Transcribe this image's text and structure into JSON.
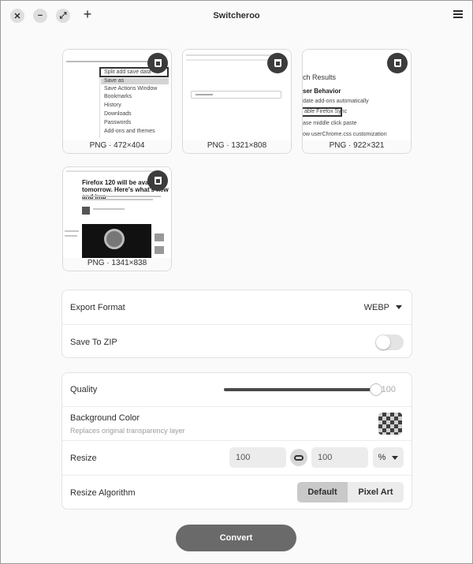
{
  "window": {
    "title": "Switcheroo"
  },
  "images": [
    {
      "label": "PNG · 472×404"
    },
    {
      "label": "PNG · 1321×808"
    },
    {
      "label": "PNG · 922×321"
    },
    {
      "label": "PNG · 1341×838"
    }
  ],
  "thumb_text": {
    "menu_items": [
      "Split add save data",
      "Save as",
      "Save Actions Window",
      "Bookmarks",
      "History",
      "Downloads",
      "Passwords",
      "Add-ons and themes"
    ],
    "search_results": "ch Results",
    "behavior": "ser Behavior",
    "opt1": "date add-ons automatically",
    "opt2": "able Firefox Sync",
    "opt3": "ase middle click paste",
    "opt4": "ow userChrome.css customization",
    "article_title": "Firefox 120 will be available tomorrow. Here's what's new and imp"
  },
  "settings": {
    "export_format": {
      "label": "Export Format",
      "value": "WEBP"
    },
    "save_zip": {
      "label": "Save To ZIP",
      "on": false
    },
    "quality": {
      "label": "Quality",
      "value": "100",
      "fraction": 1.0
    },
    "background": {
      "label": "Background Color",
      "sub": "Replaces original transparency layer"
    },
    "resize": {
      "label": "Resize",
      "width": "100",
      "height": "100",
      "unit": "%"
    },
    "algorithm": {
      "label": "Resize Algorithm",
      "options": [
        "Default",
        "Pixel Art"
      ],
      "selected": "Default"
    }
  },
  "convert_label": "Convert"
}
